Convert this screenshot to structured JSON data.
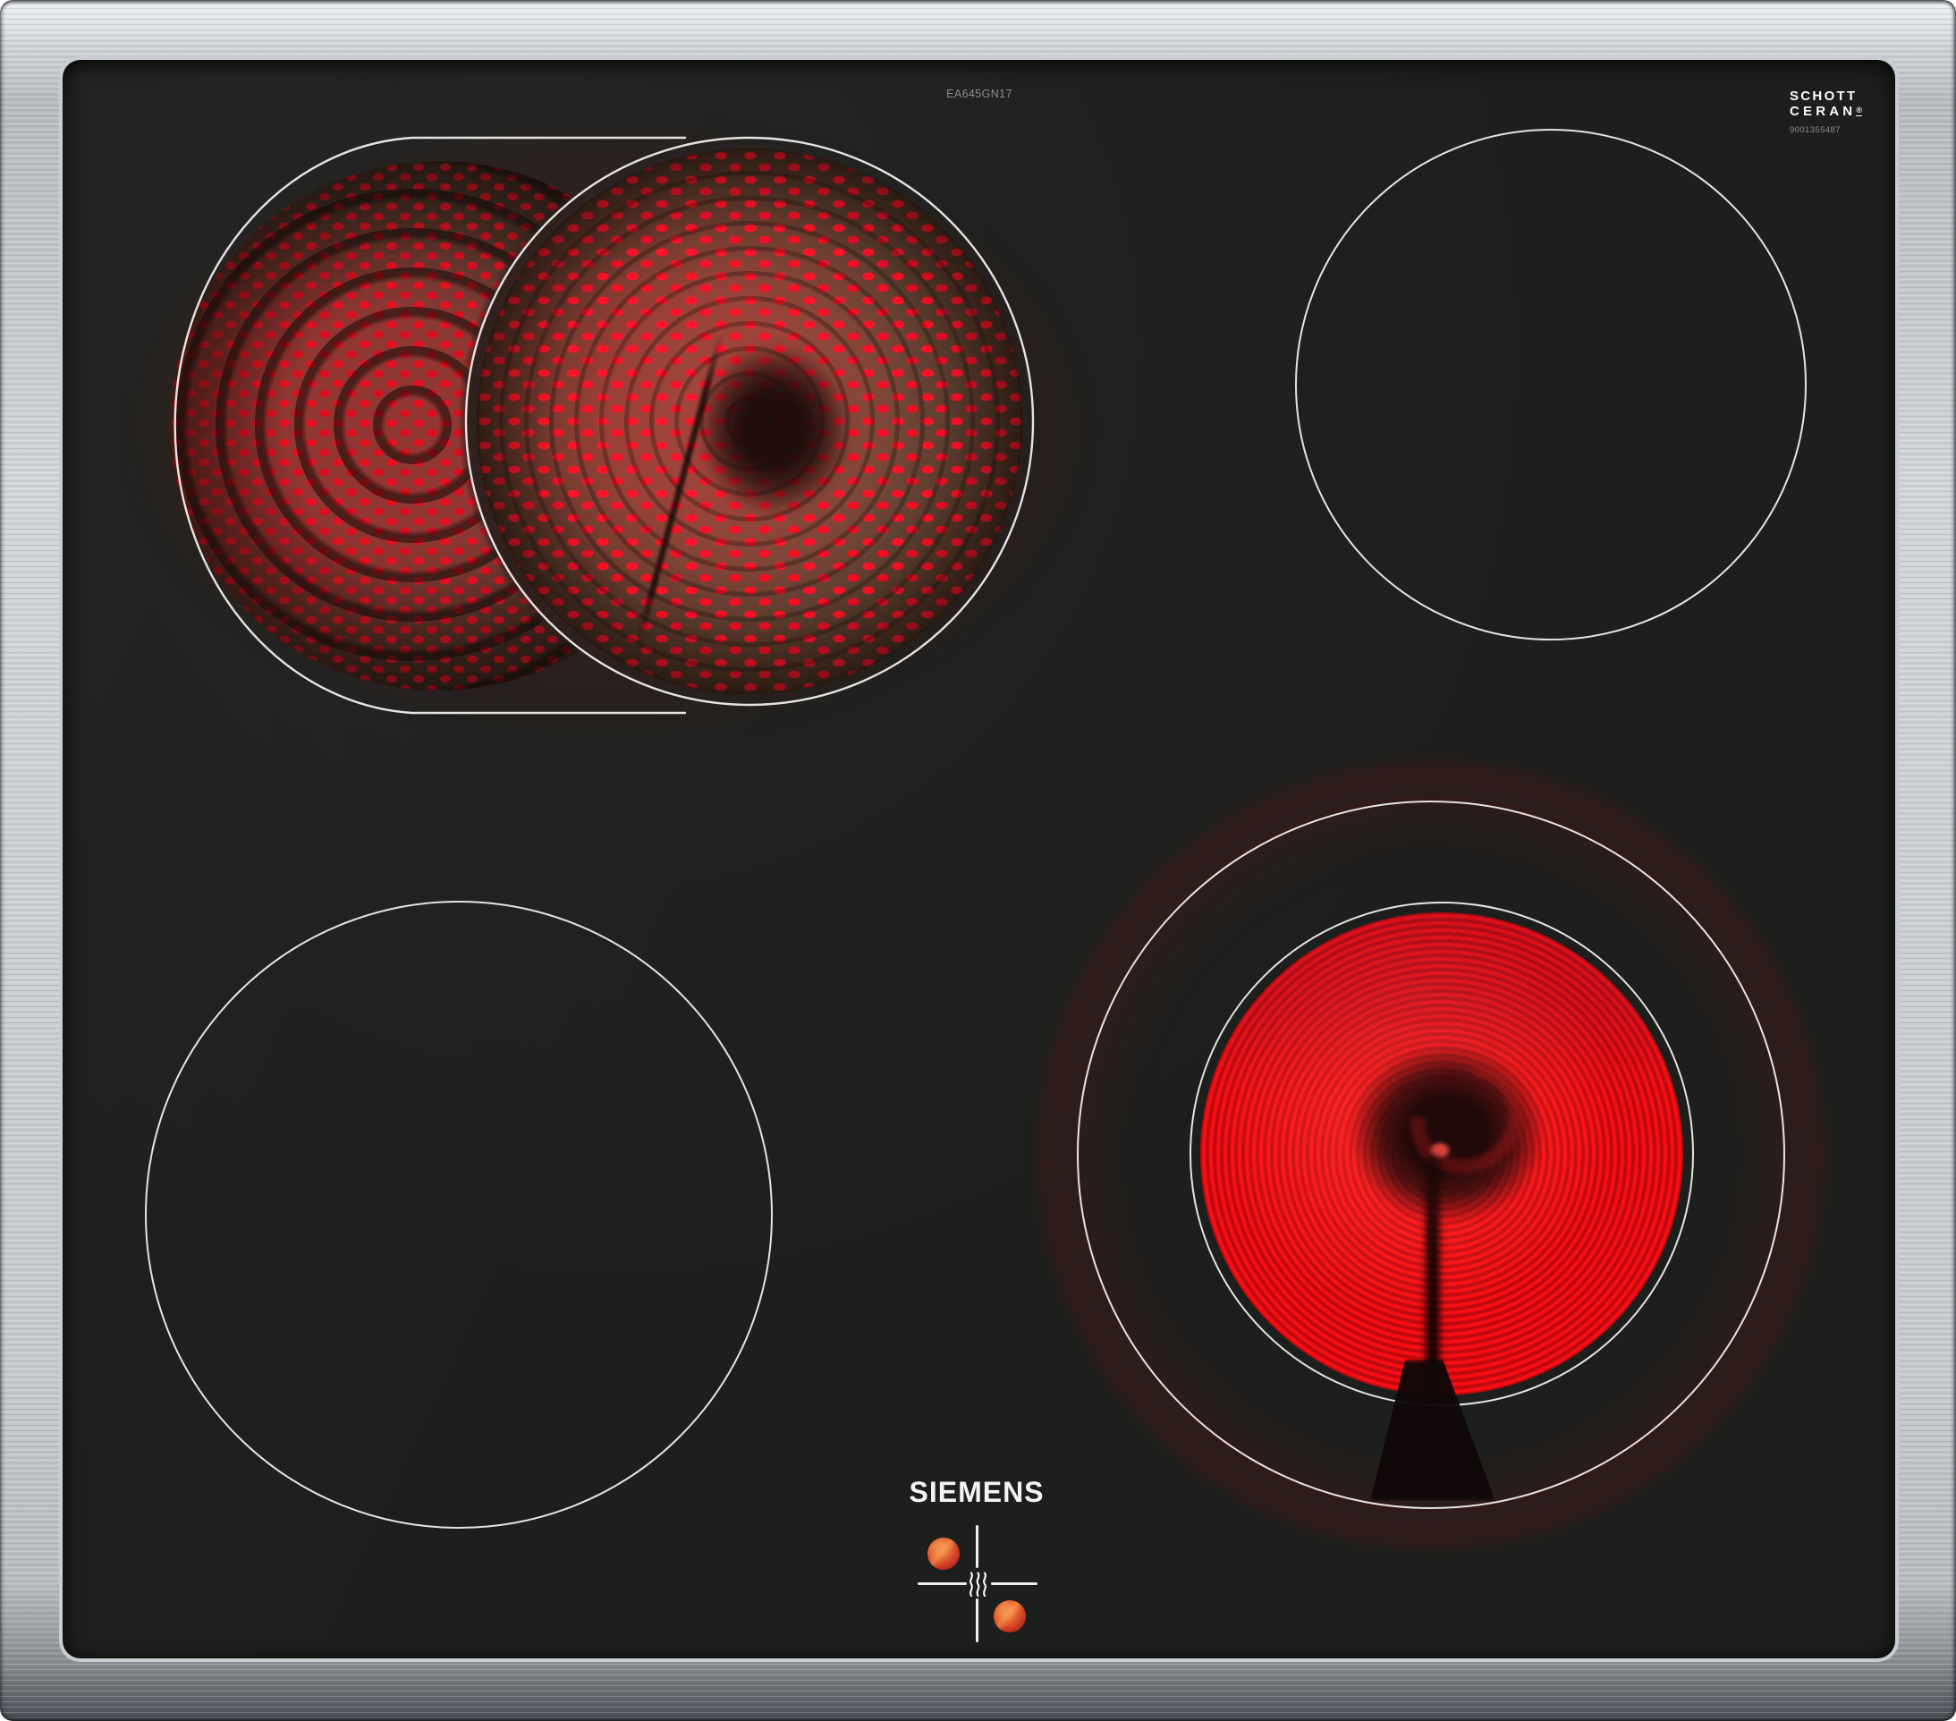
{
  "product": {
    "model_number": "EA645GN17",
    "brand_logo_text": "SIEMENS"
  },
  "glass_branding": {
    "maker_wordmark_line1": "SCHOTT",
    "maker_wordmark_line2": "CERAN",
    "registered_symbol": "®",
    "reference_number": "9001355487"
  },
  "cooking_zones": [
    {
      "position": "back-left",
      "kind": "dual-circuit roaster zone",
      "state": "on",
      "appearance": "dim red chevron crescent extension plus bright red main coil circle"
    },
    {
      "position": "back-right",
      "kind": "radiant zone",
      "state": "off",
      "appearance": "thin white outline on black glass"
    },
    {
      "position": "front-left",
      "kind": "radiant zone",
      "state": "off",
      "appearance": "thin white outline on black glass"
    },
    {
      "position": "front-right",
      "kind": "radiant zone with outer ring",
      "state": "on",
      "appearance": "bright red coil disk with glowing outer halo ring"
    }
  ],
  "control_markings": {
    "residual_heat_icon": "triple-wave-steam-icon",
    "alignment_cross": "white cross lines",
    "indicator_dot_count": 2,
    "indicator_dot_color": "#d85a2e"
  },
  "colors": {
    "glass_black": "#1d1f1d",
    "frame_metal_light": "#eef0f2",
    "frame_metal_mid": "#c3c7cb",
    "frame_metal_dark": "#55595d",
    "zone_outline_white": "#f5f5f5",
    "ember_bright_red": "#ec151b",
    "ember_deep_red": "#8a0a0e",
    "label_gray": "#8d8d8d"
  }
}
